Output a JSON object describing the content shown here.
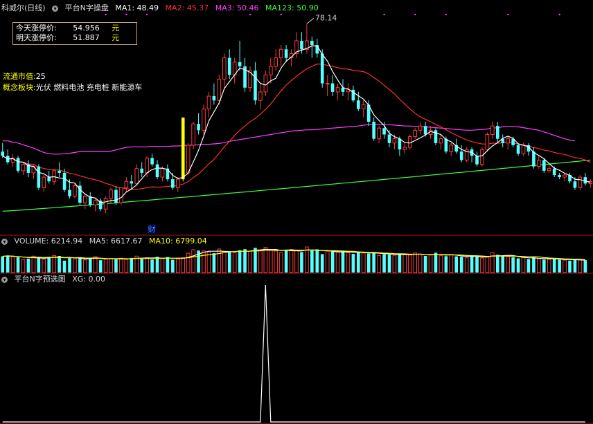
{
  "header": {
    "stock_name": "科威尔(日线)",
    "indicator_name": "平台N字操盘",
    "ma1": "MA1: 48.49",
    "ma2": "MA2: 45.37",
    "ma3": "MA3: 50.46",
    "ma123": "MA123: 50.90"
  },
  "limit_box": {
    "today_label": "今天涨停价:",
    "today_value": "54.956",
    "tomorrow_label": "明天涨停价:",
    "tomorrow_value": "51.887",
    "unit": "元"
  },
  "info": {
    "float_cap_label": "流通市值:",
    "float_cap_value": "25",
    "concept_label": "概念板块:",
    "concept_value": "光伏 燃料电池 充电桩 新能源车"
  },
  "markers": {
    "high_label": "78.14",
    "cai_label": "财"
  },
  "volume_header": {
    "volume": "VOLUME: 6214.94",
    "ma5": "MA5: 6617.67",
    "ma10": "MA10: 6799.04"
  },
  "xg_header": {
    "name": "平台N字预选图",
    "xg": "XG: 0.00"
  },
  "colors": {
    "up": "#ff3b3b",
    "down": "#54ffff",
    "ma1": "#ffffff",
    "ma2": "#ff3030",
    "ma3": "#ff40ff",
    "ma123": "#40ff40",
    "vol_ma10": "#ffff00",
    "signal_bar": "#ffff00"
  },
  "chart_data": [
    {
      "type": "candlestick",
      "title": "科威尔(日线)",
      "description": "daily candles, approx price values read from chart",
      "ylim": [
        30,
        80
      ],
      "candles": [
        [
          48,
          50,
          46.5,
          47
        ],
        [
          47,
          48.5,
          45,
          45.5
        ],
        [
          45.5,
          47.5,
          44.5,
          46.5
        ],
        [
          46.5,
          47,
          43,
          43.5
        ],
        [
          43.5,
          45.5,
          42.5,
          45
        ],
        [
          45,
          46,
          42,
          43
        ],
        [
          43,
          45,
          41.5,
          44.5
        ],
        [
          44.5,
          45,
          39,
          39.5
        ],
        [
          39.5,
          42.5,
          38.5,
          42
        ],
        [
          42,
          43.5,
          40.5,
          41
        ],
        [
          41,
          43.8,
          40.2,
          43.5
        ],
        [
          43.5,
          45.5,
          42,
          43
        ],
        [
          43,
          44,
          38.5,
          39
        ],
        [
          39,
          41.5,
          37,
          37.5
        ],
        [
          37.5,
          40.5,
          37,
          40
        ],
        [
          40,
          41,
          35.5,
          36
        ],
        [
          36,
          38,
          34.5,
          37.5
        ],
        [
          37.5,
          38.5,
          35,
          35.5
        ],
        [
          35.5,
          37,
          34,
          36.5
        ],
        [
          36.5,
          37,
          34,
          34.5
        ],
        [
          34.5,
          37.5,
          33.5,
          37
        ],
        [
          37,
          39.5,
          36,
          39
        ],
        [
          39,
          40,
          35.5,
          36
        ],
        [
          36,
          39.5,
          35.5,
          39.5
        ],
        [
          39.5,
          42,
          38.5,
          41
        ],
        [
          41,
          42.5,
          39,
          40.5
        ],
        [
          40.5,
          45,
          40,
          44
        ],
        [
          44,
          45.5,
          42,
          43
        ],
        [
          43,
          47,
          42,
          46.5
        ],
        [
          46.5,
          47.5,
          44.5,
          45
        ],
        [
          45,
          46,
          41.5,
          42
        ],
        [
          42,
          44.5,
          41,
          44
        ],
        [
          44,
          45,
          41,
          41.5
        ],
        [
          41.5,
          43,
          39,
          39.5
        ],
        [
          39.5,
          42,
          38.5,
          41.5
        ],
        [
          41.5,
          44.5,
          41,
          43
        ],
        [
          43,
          50,
          42.5,
          49.5
        ],
        [
          49.5,
          55,
          48.5,
          54.5
        ],
        [
          54.5,
          57,
          52,
          53
        ],
        [
          53,
          59,
          52,
          58
        ],
        [
          58,
          62,
          56,
          61
        ],
        [
          61,
          64,
          59,
          60
        ],
        [
          60,
          66,
          59,
          65
        ],
        [
          65,
          71,
          63,
          70
        ],
        [
          70,
          72,
          65,
          66
        ],
        [
          66,
          70,
          64,
          69
        ],
        [
          69,
          74,
          67,
          68
        ],
        [
          68,
          70,
          62,
          63
        ],
        [
          63,
          68,
          62,
          67
        ],
        [
          67,
          69,
          59,
          60
        ],
        [
          60,
          64,
          58,
          62
        ],
        [
          62,
          67,
          61,
          66
        ],
        [
          66,
          70,
          64,
          68
        ],
        [
          68,
          72,
          67,
          70
        ],
        [
          70,
          73,
          68,
          72
        ],
        [
          72,
          73,
          69,
          70
        ],
        [
          70,
          72,
          68,
          71
        ],
        [
          71,
          76,
          70,
          74
        ],
        [
          74,
          76,
          71,
          72
        ],
        [
          72,
          78,
          71,
          74
        ],
        [
          74,
          75,
          70,
          73
        ],
        [
          73,
          74.5,
          70,
          71
        ],
        [
          71,
          72,
          63,
          64
        ],
        [
          64,
          66,
          61,
          64
        ],
        [
          64,
          66,
          61,
          62
        ],
        [
          62,
          64,
          60,
          63
        ],
        [
          63,
          65,
          61,
          62
        ],
        [
          62,
          64,
          60,
          62.5
        ],
        [
          62.5,
          63.5,
          59.5,
          60
        ],
        [
          60,
          62,
          57.5,
          58
        ],
        [
          58,
          60,
          56,
          59
        ],
        [
          59,
          60,
          54,
          55
        ],
        [
          55,
          56,
          50.5,
          51
        ],
        [
          51,
          54,
          50,
          53.5
        ],
        [
          53.5,
          55,
          51,
          52
        ],
        [
          52,
          53,
          49,
          50
        ],
        [
          50,
          52,
          48.5,
          51
        ],
        [
          51,
          51.5,
          47,
          48.5
        ],
        [
          48.5,
          50,
          47.5,
          49
        ],
        [
          49,
          52,
          48.5,
          51.5
        ],
        [
          51.5,
          53.5,
          51,
          53
        ],
        [
          53,
          55,
          52,
          54
        ],
        [
          54,
          55,
          51.5,
          52
        ],
        [
          52,
          54,
          51,
          53
        ],
        [
          53,
          53.5,
          49.5,
          50
        ],
        [
          50,
          52,
          48.5,
          51
        ],
        [
          51,
          51.5,
          47.5,
          48
        ],
        [
          48,
          50,
          47,
          49.5
        ],
        [
          49.5,
          51,
          47.5,
          48
        ],
        [
          48,
          49.5,
          45.5,
          46
        ],
        [
          46,
          49,
          45.5,
          48.5
        ],
        [
          48.5,
          49,
          45.5,
          47
        ],
        [
          47,
          48,
          44.5,
          45
        ],
        [
          45,
          49,
          44.5,
          48.5
        ],
        [
          48.5,
          52.5,
          48,
          52
        ],
        [
          52,
          55,
          51,
          54
        ],
        [
          54,
          55,
          50,
          51
        ],
        [
          51,
          52,
          49,
          50
        ],
        [
          50,
          51.5,
          48.5,
          51
        ],
        [
          51,
          51.5,
          49,
          49.5
        ],
        [
          49.5,
          50,
          47,
          47.5
        ],
        [
          47.5,
          50,
          47,
          49.5
        ],
        [
          49.5,
          50,
          47,
          48
        ],
        [
          48,
          49,
          44,
          44.5
        ],
        [
          44.5,
          47,
          44,
          46
        ],
        [
          46,
          46.5,
          43,
          43.5
        ],
        [
          43.5,
          45,
          43,
          44
        ],
        [
          44,
          44.5,
          42,
          42.5
        ],
        [
          42.5,
          43,
          41.5,
          42
        ],
        [
          42,
          43,
          41,
          42.5
        ],
        [
          42.5,
          43,
          40.5,
          41
        ],
        [
          41,
          42,
          39,
          39.5
        ],
        [
          39.5,
          42.5,
          39,
          42
        ],
        [
          42,
          43,
          40,
          40.5
        ],
        [
          40.5,
          41.5,
          39.5,
          41
        ]
      ],
      "ma3_values": [
        50.5,
        50.5,
        50.2,
        50,
        49.6,
        49.2,
        48.8,
        48.3,
        47.8,
        47.5,
        47.4,
        47.4,
        47.5,
        47.6,
        47.8,
        48,
        48,
        48,
        48,
        48,
        48,
        48.1,
        48.4,
        48.7,
        49,
        49.1,
        49.1,
        49.1,
        49.1,
        49.2,
        49.2,
        49.2,
        49.2,
        49.3,
        49.3,
        49.4,
        49.5,
        49.5,
        49.6,
        49.7,
        49.7,
        49.8,
        49.9,
        50.1,
        50.4,
        50.6,
        50.8,
        51,
        51.2,
        51.4,
        51.6,
        51.8,
        52,
        52.2,
        52.4,
        52.6,
        52.8,
        52.9,
        53,
        53.1,
        53.1,
        53.2,
        53.3,
        53.4,
        53.5,
        53.6,
        53.7,
        53.8,
        53.9,
        54,
        54.2,
        54.3,
        54.3,
        54.3,
        54.3,
        54.3,
        54.2,
        54.1,
        54,
        54,
        53.9,
        53.9,
        53.8,
        53.7,
        53.6,
        53.5,
        53.4,
        53.3,
        53.2,
        53.1,
        53,
        53,
        53.1,
        53.2,
        53.3,
        53.5,
        53.6,
        53.8,
        53.9,
        53.9,
        53.8,
        53.6,
        53.4,
        53.2,
        53,
        52.6,
        52.2,
        51.8,
        51.4,
        51,
        50.7,
        50.5
      ]
    },
    {
      "type": "bar",
      "title": "VOLUME",
      "description": "approx daily volumes (relative units) aligned with candles",
      "values": [
        7200,
        7600,
        7000,
        6800,
        5800,
        6200,
        7300,
        6600,
        5900,
        7000,
        7600,
        7400,
        5300,
        6400,
        6100,
        6800,
        5600,
        6200,
        7100,
        5500,
        6000,
        6300,
        5900,
        6400,
        5800,
        6500,
        7300,
        6100,
        6600,
        5800,
        7000,
        6200,
        6900,
        5700,
        6000,
        6600,
        8600,
        10200,
        9800,
        9600,
        9200,
        8600,
        10500,
        9300,
        9100,
        8800,
        9900,
        10400,
        9500,
        11000,
        9700,
        11200,
        9900,
        9600,
        8800,
        10100,
        10300,
        9700,
        9100,
        11400,
        9800,
        10300,
        8200,
        9500,
        9300,
        9000,
        9600,
        8800,
        8300,
        9300,
        8700,
        8500,
        9000,
        7600,
        8200,
        8000,
        7700,
        8400,
        7900,
        7800,
        8700,
        8200,
        7400,
        7800,
        8800,
        7500,
        7300,
        8000,
        7200,
        7000,
        6600,
        7600,
        7000,
        6500,
        7000,
        8900,
        7900,
        7300,
        7100,
        6800,
        6300,
        6600,
        6000,
        6800,
        6100,
        5800,
        5900,
        6400,
        5700,
        5500,
        5300,
        5900,
        5600,
        5500
      ]
    },
    {
      "type": "line",
      "title": "平台N字预选图",
      "description": "XG signal, single spike",
      "ylim": [
        0,
        1
      ],
      "values": [
        0,
        0,
        0,
        0,
        0,
        0,
        0,
        0,
        0,
        0,
        0,
        0,
        0,
        0,
        0,
        0,
        0,
        0,
        0,
        0,
        0,
        0,
        0,
        0,
        0,
        0,
        0,
        0,
        0,
        0,
        0,
        0,
        0,
        0,
        0,
        0,
        0,
        0,
        0,
        0,
        0,
        0,
        0,
        0,
        0,
        0,
        0,
        0,
        0,
        0,
        0,
        1,
        0,
        0,
        0,
        0,
        0,
        0,
        0,
        0,
        0,
        0,
        0,
        0,
        0,
        0,
        0,
        0,
        0,
        0,
        0,
        0,
        0,
        0,
        0,
        0,
        0,
        0,
        0,
        0,
        0,
        0,
        0,
        0,
        0,
        0,
        0,
        0,
        0,
        0,
        0,
        0,
        0,
        0,
        0,
        0,
        0,
        0,
        0,
        0,
        0,
        0,
        0,
        0,
        0,
        0,
        0,
        0,
        0,
        0,
        0,
        0,
        0,
        0
      ]
    }
  ]
}
